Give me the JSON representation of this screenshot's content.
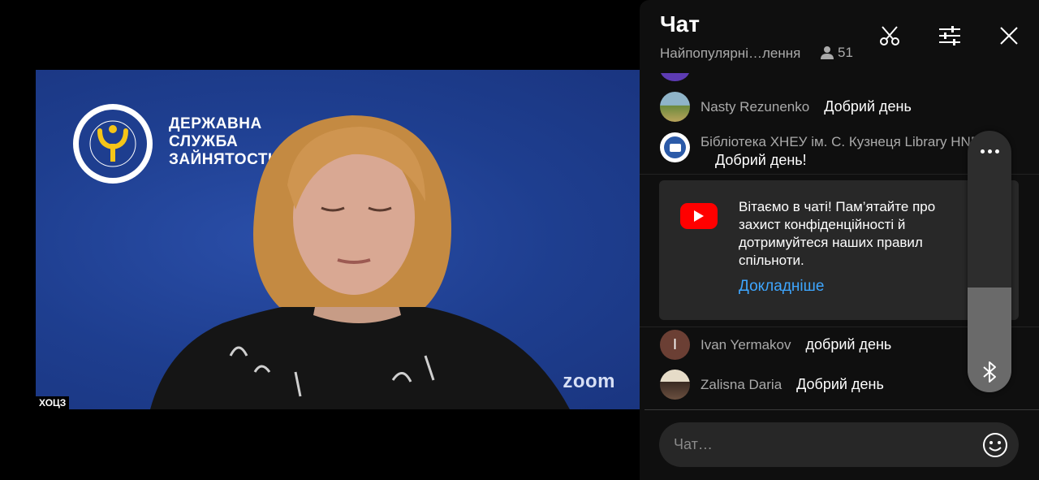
{
  "video": {
    "org_line1": "ДЕРЖАВНА",
    "org_line2": "СЛУЖБА",
    "org_line3": "ЗАЙНЯТОСТІ",
    "brand_watermark": "zoom",
    "participant_tag": "ХОЦЗ",
    "logo_text": "ДЕРЖАВНА СЛУЖБА ЗАЙНЯТОСТІ"
  },
  "chat": {
    "title": "Чат",
    "mode": "Найпопулярні…лення",
    "viewers": "51",
    "icons": {
      "clip": "scissors-icon",
      "settings": "sliders-icon",
      "close": "close-icon"
    },
    "messages": [
      {
        "author": "Nasty Rezunenko",
        "text": "Добрий день",
        "avatar": "nature-photo"
      },
      {
        "author": "Бібліотека ХНЕУ ім. С. Кузнеця Library HNEUE",
        "text": "Добрий день!",
        "avatar": "library-logo"
      },
      {
        "author": "Ivan Yermakov",
        "text": "добрий день",
        "avatar_letter": "I",
        "avatar_color": "#6b3f34"
      },
      {
        "author": "Zalisna Daria",
        "text": "Добрий день",
        "avatar": "person-photo"
      }
    ],
    "notice": {
      "text": "Вітаємо в чаті! Пам’ятайте про захист конфіденційності й дотримуйтеся наших правил спільноти.",
      "link": "Докладніше"
    },
    "input_placeholder": "Чат…"
  },
  "overlay": {
    "volume_level": 0.4
  },
  "colors": {
    "accent_link": "#3ea6ff",
    "youtube_red": "#ff0000",
    "panel_bg": "#0f0f0f",
    "video_bg": "#1e3e8f"
  }
}
